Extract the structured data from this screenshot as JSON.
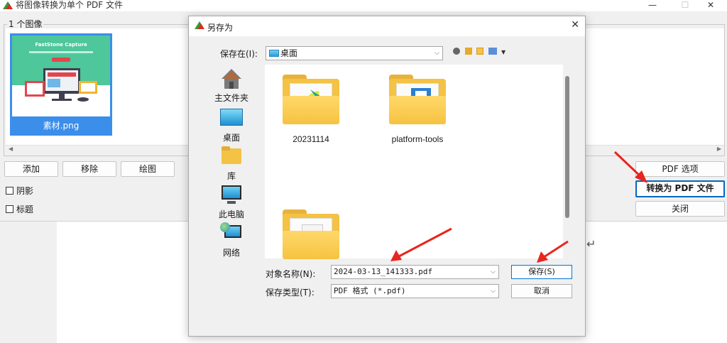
{
  "main_window": {
    "title": "将图像转换为单个 PDF 文件",
    "controls": {
      "minimize": "—",
      "maximize": "☐",
      "close": "✕"
    },
    "image_group_label": "1 个图像",
    "thumbnail": {
      "caption": "素材.png",
      "brand": "FastStone Capture"
    },
    "buttons": {
      "add": "添加",
      "remove": "移除",
      "draw": "绘图",
      "pdf_options": "PDF 选项",
      "convert": "转换为 PDF 文件",
      "close": "关闭"
    },
    "checkboxes": {
      "shadow": "阴影",
      "caption": "标题"
    }
  },
  "background": {
    "paragraph_mark": "↵"
  },
  "save_dialog": {
    "title": "另存为",
    "close_glyph": "✕",
    "save_in_label": "保存在(I):",
    "save_in_value": "桌面",
    "places": [
      {
        "label": "主文件夹"
      },
      {
        "label": "桌面"
      },
      {
        "label": "库"
      },
      {
        "label": "此电脑"
      },
      {
        "label": "网络"
      }
    ],
    "folders": [
      {
        "name": "20231114"
      },
      {
        "name": "platform-tools"
      },
      {
        "name": ""
      }
    ],
    "filename_label": "对象名称(N):",
    "filename_value": "2024-03-13_141333.pdf",
    "filetype_label": "保存类型(T):",
    "filetype_value": "PDF 格式 (*.pdf)",
    "save_button": "保存(S)",
    "cancel_button": "取消"
  },
  "colors": {
    "accent": "#0067c0",
    "arrow": "#e8261f",
    "folder": "#f4c244",
    "thumbnail_bg": "#3b8eea"
  }
}
